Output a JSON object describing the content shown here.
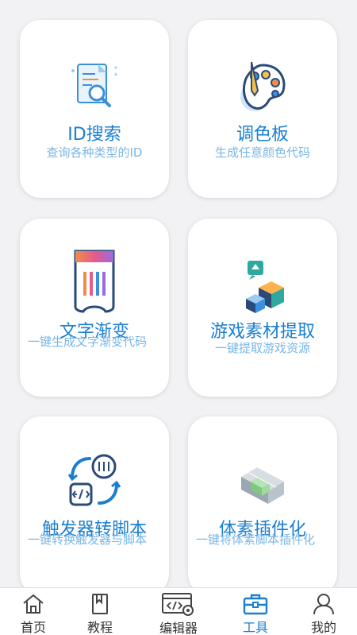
{
  "cards": [
    {
      "title": "ID搜索",
      "subtitle": "查询各种类型的ID",
      "icon": "document-search-icon"
    },
    {
      "title": "调色板",
      "subtitle": "生成任意颜色代码",
      "icon": "palette-icon"
    },
    {
      "title": "文字渐变",
      "subtitle": "一键生成文字渐变代码",
      "icon": "gradient-ticket-icon"
    },
    {
      "title": "游戏素材提取",
      "subtitle": "一键提取游戏资源",
      "icon": "asset-extract-icon"
    },
    {
      "title": "触发器转脚本",
      "subtitle": "一键转换触发器与脚本",
      "icon": "convert-code-icon"
    },
    {
      "title": "体素插件化",
      "subtitle": "一键将体素脚本插件化",
      "icon": "voxel-cube-icon"
    }
  ],
  "tabbar": {
    "items": [
      {
        "label": "首页",
        "icon": "home-icon"
      },
      {
        "label": "教程",
        "icon": "bookmark-book-icon"
      },
      {
        "label": "编辑器",
        "icon": "code-gear-icon"
      },
      {
        "label": "工具",
        "icon": "toolbox-icon",
        "active": true
      },
      {
        "label": "我的",
        "icon": "person-icon"
      }
    ]
  },
  "colors": {
    "accent": "#1a7fd1",
    "subtitle": "#79b6e6"
  }
}
